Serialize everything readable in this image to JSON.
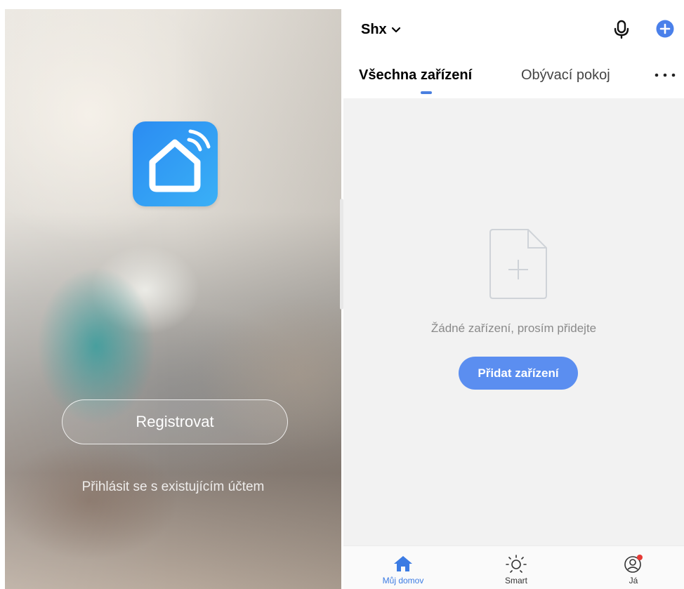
{
  "login_screen": {
    "register_label": "Registrovat",
    "login_existing_label": "Přihlásit se s existujícím účtem",
    "logo_icon": "smart-home-wifi-icon",
    "accent_color": "#2b8cf2"
  },
  "home_screen": {
    "home_name": "Shx",
    "icons": {
      "dropdown": "chevron-down-icon",
      "voice": "microphone-icon",
      "add": "plus-circle-icon",
      "more": "more-horizontal-icon"
    },
    "tabs": [
      {
        "label": "Všechna zařízení",
        "active": true
      },
      {
        "label": "Obývací pokoj",
        "active": false
      }
    ],
    "empty_state": {
      "icon": "add-document-icon",
      "message": "Žádné zařízení, prosím přidejte",
      "button_label": "Přidat zařízení"
    },
    "bottom_nav": [
      {
        "label": "Můj domov",
        "icon": "home-icon",
        "active": true
      },
      {
        "label": "Smart",
        "icon": "sun-icon",
        "active": false
      },
      {
        "label": "Já",
        "icon": "user-icon",
        "active": false,
        "badge": true
      }
    ],
    "accent_color": "#5b8ef0"
  }
}
